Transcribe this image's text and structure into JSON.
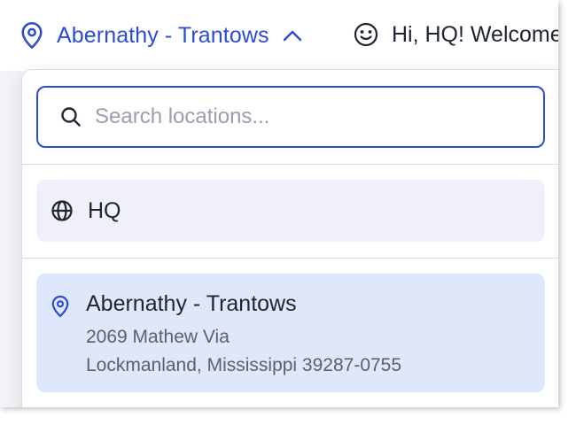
{
  "header": {
    "current_location": "Abernathy - Trantows",
    "greeting": "Hi, HQ! Welcome"
  },
  "dropdown": {
    "search": {
      "value": "",
      "placeholder": "Search locations..."
    },
    "items": [
      {
        "label": "HQ",
        "icon": "globe-icon"
      },
      {
        "label": "Abernathy - Trantows",
        "icon": "map-pin-icon",
        "address_line1": "2069 Mathew Via",
        "address_line2": "Lockmanland, Mississippi 39287-0755",
        "selected": true
      }
    ]
  },
  "colors": {
    "accent": "#2b4bd8",
    "selected_bg": "#dfe8fb",
    "hover_bg": "#f0f1f8",
    "text": "#1f2433",
    "muted_text": "#5a5f72"
  }
}
